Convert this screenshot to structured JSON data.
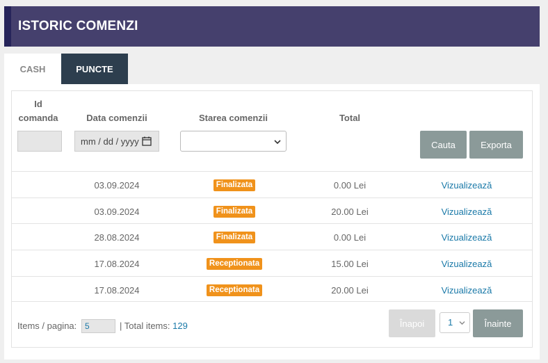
{
  "header": {
    "title": "ISTORIC COMENZI"
  },
  "tabs": [
    {
      "label": "CASH"
    },
    {
      "label": "PUNCTE"
    }
  ],
  "columns": {
    "id_line1": "Id",
    "id_line2": "comanda",
    "date": "Data comenzii",
    "status": "Starea comenzii",
    "total": "Total"
  },
  "filters": {
    "date_placeholder": "mm / dd / yyyy",
    "status_selected": ""
  },
  "buttons": {
    "search": "Cauta",
    "export": "Exporta"
  },
  "rows": [
    {
      "date": "03.09.2024",
      "status": "Finalizata",
      "total": "0.00 Lei",
      "action": "Vizualizează"
    },
    {
      "date": "03.09.2024",
      "status": "Finalizata",
      "total": "20.00 Lei",
      "action": "Vizualizează"
    },
    {
      "date": "28.08.2024",
      "status": "Finalizata",
      "total": "0.00 Lei",
      "action": "Vizualizează"
    },
    {
      "date": "17.08.2024",
      "status": "Receptionata",
      "total": "15.00 Lei",
      "action": "Vizualizează"
    },
    {
      "date": "17.08.2024",
      "status": "Receptionata",
      "total": "20.00 Lei",
      "action": "Vizualizează"
    }
  ],
  "pagination": {
    "items_label": "Items / pagina:",
    "items_per_page": "5",
    "total_label": "| Total items:",
    "total_count": "129",
    "prev": "Înapoi",
    "page": "1",
    "next": "Înainte"
  },
  "colors": {
    "header_bg": "#45406d",
    "active_tab": "#2d3e4e",
    "badge": "#f0921b",
    "link": "#1a79a8",
    "button": "#8b9a99"
  }
}
